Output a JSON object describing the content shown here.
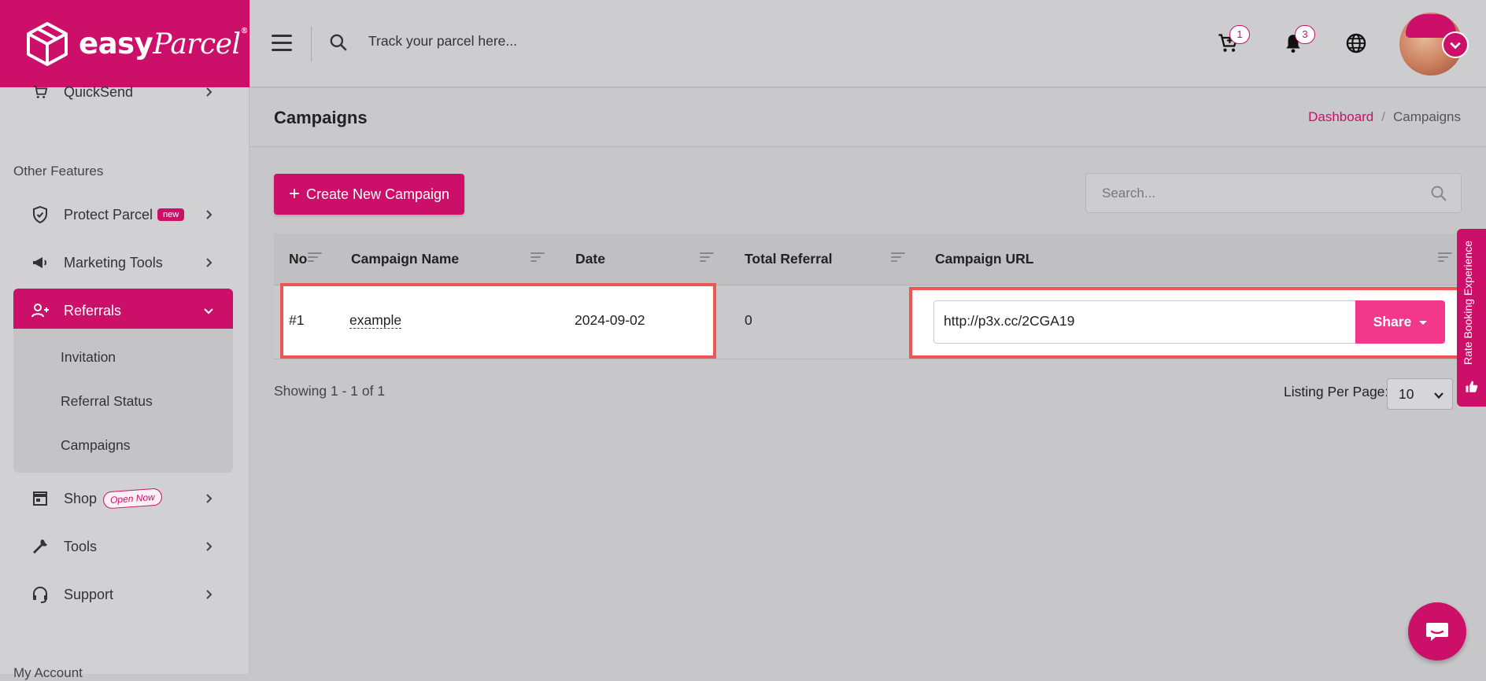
{
  "brand": {
    "name": "easy",
    "script": "Parcel",
    "reg": "®",
    "color": "#cc0f68"
  },
  "topbar": {
    "search_placeholder": "Track your parcel here...",
    "cart_count": "1",
    "notif_count": "3"
  },
  "sidebar": {
    "quicksend_label": "QuickSend",
    "section_other": "Other Features",
    "items": [
      {
        "label": "Protect Parcel",
        "badge": "new",
        "icon": "shield-icon"
      },
      {
        "label": "Marketing Tools",
        "icon": "megaphone-icon"
      },
      {
        "label": "Referrals",
        "icon": "user-plus-icon",
        "active": true
      },
      {
        "label": "Shop",
        "badge": "Open Now",
        "icon": "store-icon"
      },
      {
        "label": "Tools",
        "icon": "wrench-icon"
      },
      {
        "label": "Support",
        "icon": "headset-icon"
      }
    ],
    "subitems": [
      "Invitation",
      "Referral Status",
      "Campaigns"
    ],
    "my_account": "My Account"
  },
  "page": {
    "title": "Campaigns",
    "breadcrumb": {
      "home": "Dashboard",
      "separator": "/",
      "current": "Campaigns"
    }
  },
  "actions": {
    "create_label": "Create New Campaign",
    "search_placeholder": "Search..."
  },
  "table": {
    "columns": [
      "No",
      "Campaign Name",
      "Date",
      "Total Referral",
      "Campaign URL"
    ],
    "rows": [
      {
        "no": "#1",
        "name": "example",
        "date": "2024-09-02",
        "total": "0",
        "url": "http://p3x.cc/2CGA19",
        "share": "Share"
      }
    ]
  },
  "footer": {
    "showing": "Showing 1 - 1 of 1",
    "per_page_label": "Listing Per Page:",
    "per_page_value": "10"
  },
  "feedback_tab": {
    "label": "Rate Booking Experience"
  }
}
